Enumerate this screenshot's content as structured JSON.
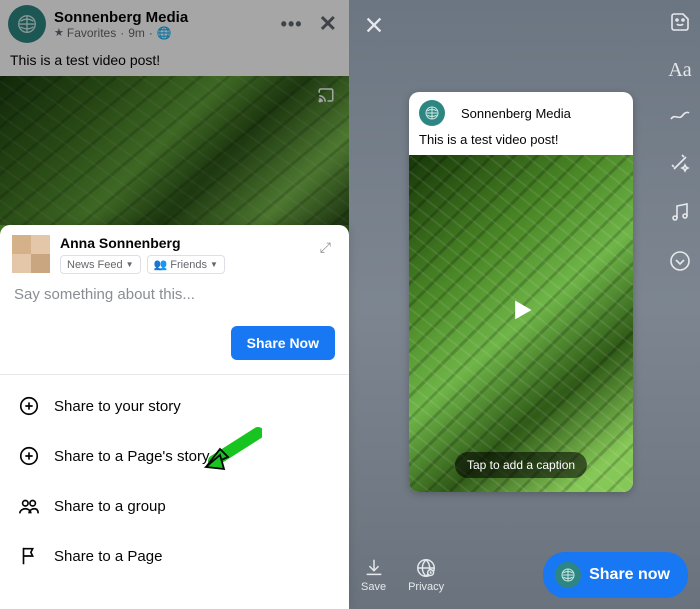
{
  "left": {
    "page_name": "Sonnenberg Media",
    "favorites_label": "Favorites",
    "post_age": "9m",
    "globe_icon": "globe-icon",
    "post_text": "This is a test video post!"
  },
  "share_sheet": {
    "user_name": "Anna Sonnenberg",
    "audience_feed": "News Feed",
    "audience_friends": "Friends",
    "caption_placeholder": "Say something about this...",
    "share_now_label": "Share Now",
    "options": {
      "your_story": "Share to your story",
      "page_story": "Share to a Page's story",
      "group": "Share to a group",
      "page": "Share to a Page"
    }
  },
  "right": {
    "page_name": "Sonnenberg Media",
    "post_text": "This is a test video post!",
    "caption_prompt": "Tap to add a caption",
    "save_label": "Save",
    "privacy_label": "Privacy",
    "share_now_label": "Share now"
  },
  "colors": {
    "accent": "#1877f2",
    "brand": "#2d8682",
    "arrow": "#18c41f"
  }
}
